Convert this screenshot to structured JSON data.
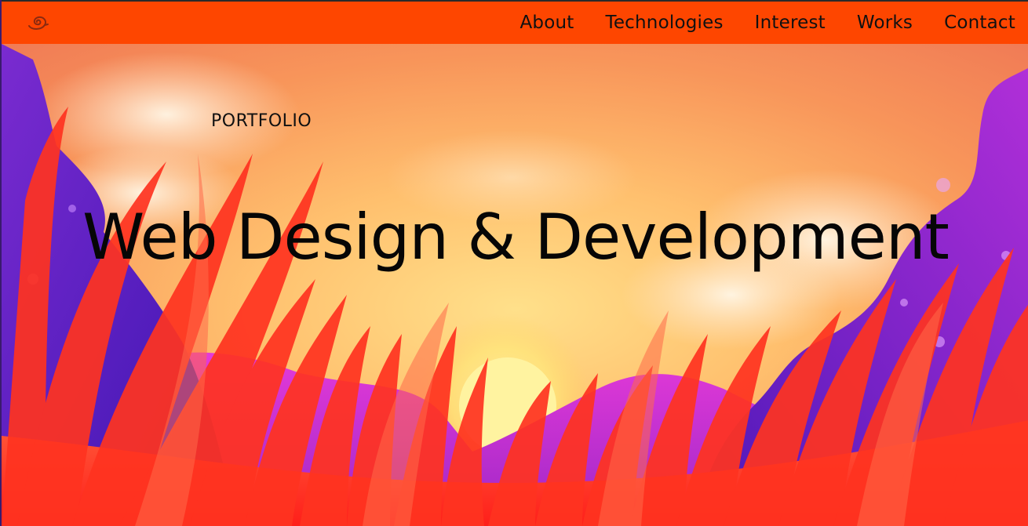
{
  "nav": {
    "logo_icon": "leaf-swirl-icon",
    "links": [
      "About",
      "Technologies",
      "Interest",
      "Works",
      "Contact"
    ]
  },
  "hero": {
    "kicker": "PORTFOLIO",
    "headline": "Web Design & Development"
  },
  "colors": {
    "nav_background": "#fe4600",
    "text": "#111111",
    "sky_top": "#f58a52",
    "sky_center": "#ffd27a",
    "mountain": "#9b2fd6",
    "grass": "#ff2a1c"
  }
}
